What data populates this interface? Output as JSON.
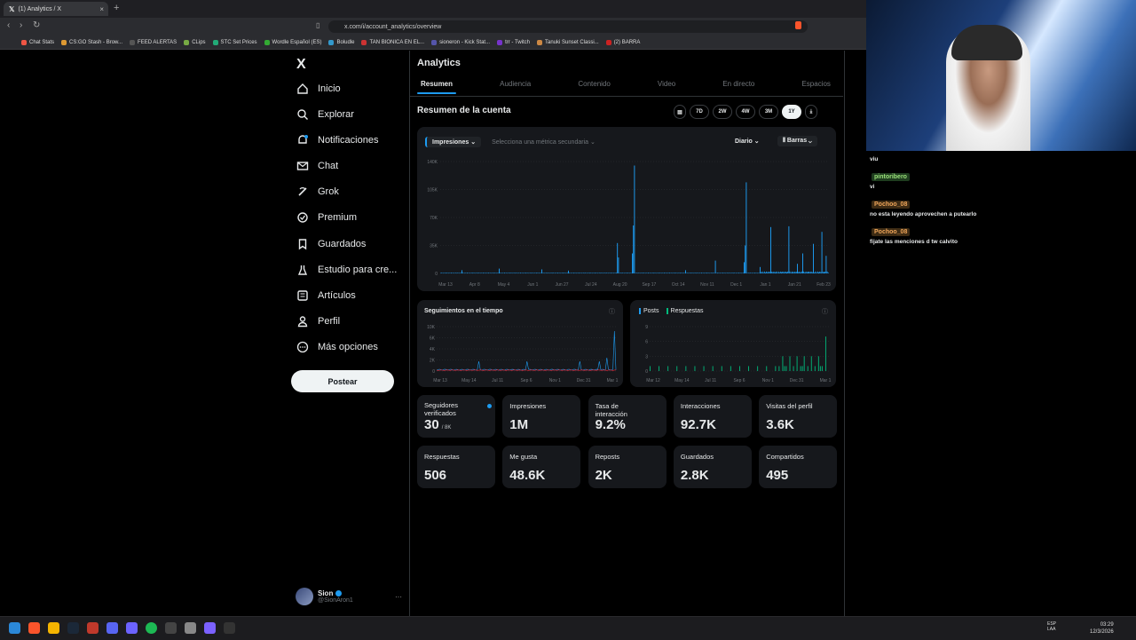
{
  "browser": {
    "tab_title": "(1) Analytics / X",
    "tab_close": "×",
    "new_tab": "+",
    "url": "x.com/i/account_analytics/overview",
    "bookmarks": [
      "Chat Stats",
      "CS:GO Stash - Brow...",
      "FEED ALERTAS",
      "CLips",
      "STC Set Prices",
      "Wordle Español (ES)",
      "Boludle",
      "TAN BIONICA EN EL...",
      "sioneron - Kick Stat...",
      "trr - Twitch",
      "Tanuki Sunset Classi...",
      "(2) BARRA"
    ]
  },
  "sidebar": {
    "logo": "X",
    "items": [
      {
        "label": "Inicio",
        "icon": "home-icon"
      },
      {
        "label": "Explorar",
        "icon": "search-icon"
      },
      {
        "label": "Notificaciones",
        "icon": "bell-icon"
      },
      {
        "label": "Chat",
        "icon": "mail-icon"
      },
      {
        "label": "Grok",
        "icon": "grok-icon"
      },
      {
        "label": "Premium",
        "icon": "premium-icon"
      },
      {
        "label": "Guardados",
        "icon": "bookmark-icon"
      },
      {
        "label": "Estudio para cre...",
        "icon": "flask-icon"
      },
      {
        "label": "Artículos",
        "icon": "article-icon"
      },
      {
        "label": "Perfil",
        "icon": "person-icon"
      },
      {
        "label": "Más opciones",
        "icon": "more-icon"
      }
    ],
    "post_label": "Postear",
    "profile": {
      "name": "Sion",
      "handle": "@SionAron1",
      "more": "···"
    }
  },
  "main": {
    "header": "Analytics",
    "tabs": [
      "Resumen",
      "Audiencia",
      "Contenido",
      "Video",
      "En directo",
      "Espacios"
    ],
    "section_title": "Resumen de la cuenta",
    "ranges": [
      "7D",
      "2W",
      "4W",
      "3M",
      "1Y"
    ],
    "selected_range": "1Y",
    "metric_primary": "Impresiones",
    "metric_secondary_placeholder": "Selecciona una métrica secundaria",
    "interval": "Diario",
    "chart_type_label": "Barras",
    "followers_title": "Seguimientos en el tiempo",
    "posts_legend": [
      "Posts",
      "Respuestas"
    ],
    "stats": [
      {
        "label": "Seguidores verificados",
        "value": "30",
        "sub": "/ 8K"
      },
      {
        "label": "Impresiones",
        "value": "1M"
      },
      {
        "label": "Tasa de interacción",
        "value": "9.2%"
      },
      {
        "label": "Interacciones",
        "value": "92.7K"
      },
      {
        "label": "Visitas del perfil",
        "value": "3.6K"
      },
      {
        "label": "Respuestas",
        "value": "506"
      },
      {
        "label": "Me gusta",
        "value": "48.6K"
      },
      {
        "label": "Reposts",
        "value": "2K"
      },
      {
        "label": "Guardados",
        "value": "2.8K"
      },
      {
        "label": "Compartidos",
        "value": "495"
      }
    ]
  },
  "chart_data": [
    {
      "type": "bar",
      "title": "Impresiones",
      "x_ticks": [
        "Mar 13",
        "Apr 8",
        "May 4",
        "Jun 1",
        "Jun 27",
        "Jul 24",
        "Aug 20",
        "Sep 17",
        "Oct 14",
        "Nov 11",
        "Dec 1",
        "Jan 1",
        "Jan 21",
        "Feb 23"
      ],
      "y_ticks": [
        "0",
        "35K",
        "70K",
        "105K",
        "140K"
      ],
      "ylim": [
        0,
        140000
      ],
      "x_count": 365,
      "peaks": [
        {
          "i": 182,
          "v": 135000
        },
        {
          "i": 181,
          "v": 60000
        },
        {
          "i": 180,
          "v": 25000
        },
        {
          "i": 166,
          "v": 38000
        },
        {
          "i": 167,
          "v": 20000
        },
        {
          "i": 287,
          "v": 114000
        },
        {
          "i": 286,
          "v": 35000
        },
        {
          "i": 285,
          "v": 14000
        },
        {
          "i": 258,
          "v": 16000
        },
        {
          "i": 310,
          "v": 58000
        },
        {
          "i": 327,
          "v": 59000
        },
        {
          "i": 340,
          "v": 25000
        },
        {
          "i": 350,
          "v": 37000
        },
        {
          "i": 358,
          "v": 52000
        },
        {
          "i": 362,
          "v": 22000
        },
        {
          "i": 335,
          "v": 12000
        },
        {
          "i": 55,
          "v": 6000
        },
        {
          "i": 20,
          "v": 4000
        },
        {
          "i": 95,
          "v": 5000
        },
        {
          "i": 120,
          "v": 3500
        },
        {
          "i": 230,
          "v": 4000
        },
        {
          "i": 300,
          "v": 8000
        }
      ],
      "baseline": 800,
      "color": "#1d9bf0"
    },
    {
      "type": "line",
      "title": "Seguimientos en el tiempo",
      "x_ticks": [
        "Mar 13",
        "May 14",
        "Jul 11",
        "Sep 6",
        "Nov 1",
        "Dec 31",
        "Mar 1"
      ],
      "y_ticks": [
        "0",
        "2K",
        "4K",
        "6K",
        "10K"
      ],
      "ylim": [
        0,
        10000
      ],
      "series": [
        {
          "color": "#1d9bf0"
        },
        {
          "color": "#f4212e"
        }
      ]
    },
    {
      "type": "bar",
      "title": "Posts / Respuestas",
      "x_ticks": [
        "Mar 12",
        "May 14",
        "Jul 11",
        "Sep 6",
        "Nov 1",
        "Dec 31",
        "Mar 1"
      ],
      "y_ticks": [
        "0",
        "3",
        "6",
        "9"
      ],
      "ylim": [
        0,
        9
      ],
      "series": [
        {
          "name": "Posts",
          "color": "#1d9bf0"
        },
        {
          "name": "Respuestas",
          "color": "#00ba7c"
        }
      ]
    }
  ],
  "chat": {
    "messages": [
      {
        "user": "",
        "text": "viu"
      },
      {
        "user": "pintoribero",
        "text": "vi",
        "color": "#1f3d1f",
        "name_color": "#9be27a"
      },
      {
        "user": "Pochoo_08",
        "text": "no esta leyendo aprovechen a putearlo",
        "color": "#3d2b14",
        "name_color": "#f0a65a"
      },
      {
        "user": "Pochoo_08",
        "text": "fijate las menciones d tw calvito",
        "color": "#3d2b14",
        "name_color": "#f0a65a"
      }
    ]
  },
  "taskbar": {
    "lang": "ESP\nLAA",
    "time": "03:29",
    "date": "12/3/2026"
  }
}
